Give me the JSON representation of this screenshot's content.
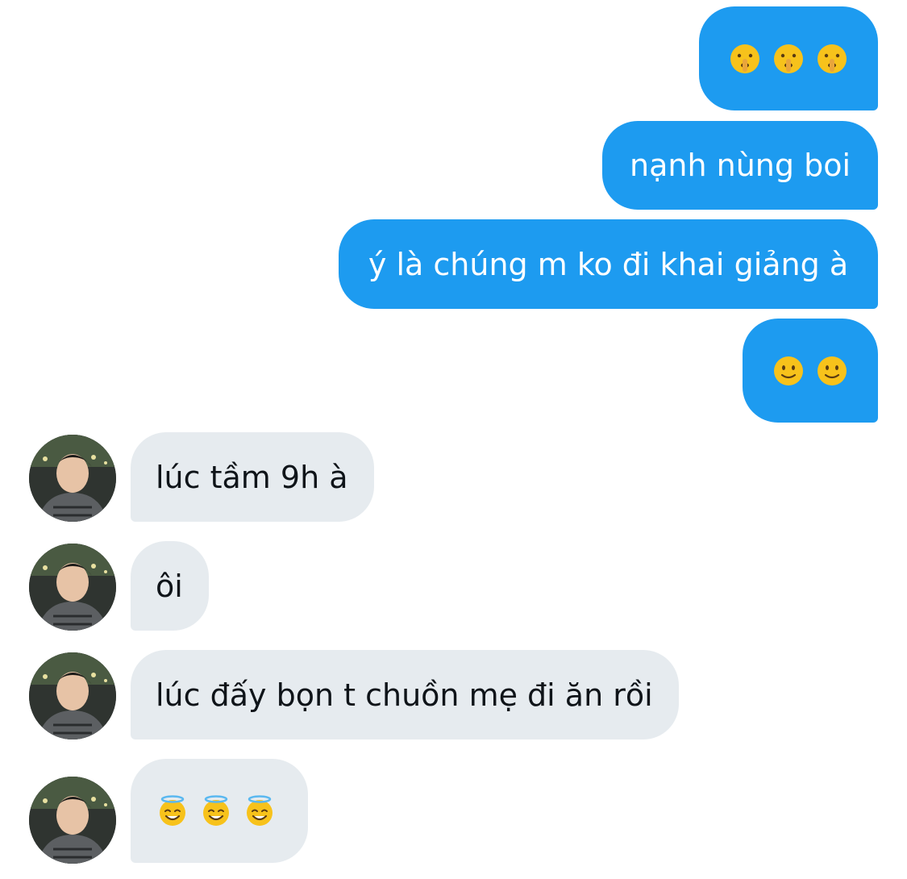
{
  "conversation": {
    "outgoing": [
      {
        "type": "emoji",
        "emojis": [
          "🤫",
          "🤫",
          "🤫"
        ],
        "icon": "shushing-face-icon"
      },
      {
        "type": "text",
        "text": "nạnh nùng boi"
      },
      {
        "type": "text",
        "text": "ý là chúng m ko đi khai giảng à"
      },
      {
        "type": "emoji",
        "emojis": [
          "🙂",
          "🙂"
        ],
        "icon": "slightly-smiling-face-icon"
      }
    ],
    "incoming": [
      {
        "type": "text",
        "text": "lúc tầm 9h à"
      },
      {
        "type": "text",
        "text": "ôi"
      },
      {
        "type": "text",
        "text": "lúc đấy bọn t chuồn mẹ đi ăn rồi"
      },
      {
        "type": "emoji",
        "emojis": [
          "😇",
          "😇",
          "😇"
        ],
        "icon": "smiling-face-with-halo-icon"
      }
    ]
  },
  "colors": {
    "outgoing_bubble": "#1d9bf0",
    "incoming_bubble": "#e6ebef",
    "incoming_text": "#0f1419"
  }
}
